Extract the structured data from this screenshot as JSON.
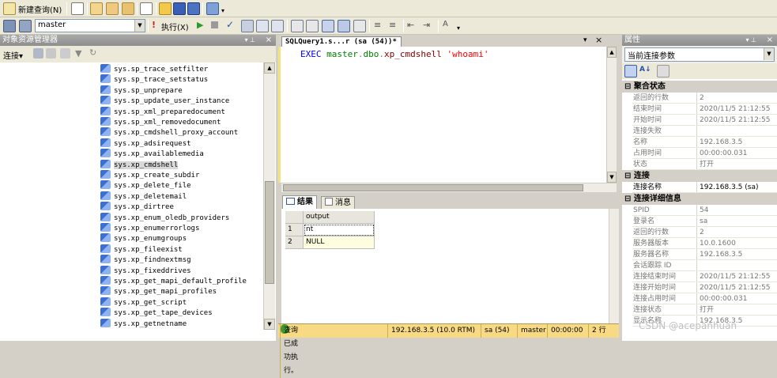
{
  "toolbar1": {
    "new_query_label": "新建查询(N)",
    "icons": [
      "db-engine-query-icon",
      "analysis-query-icon",
      "mdx-query-icon",
      "dmx-query-icon",
      "xmla-query-icon",
      "new-file-icon",
      "open-file-icon",
      "save-icon",
      "save-all-icon",
      "registered-servers-icon",
      "overflow-icon"
    ]
  },
  "toolbar2": {
    "database": "master",
    "execute_label": "执行(X)"
  },
  "object_explorer": {
    "title": "对象资源管理器",
    "connect_label": "连接",
    "items": [
      "sys.sp_trace_setfilter",
      "sys.sp_trace_setstatus",
      "sys.sp_unprepare",
      "sys.sp_update_user_instance",
      "sys.sp_xml_preparedocument",
      "sys.sp_xml_removedocument",
      "sys.xp_cmdshell_proxy_account",
      "sys.xp_adsirequest",
      "sys.xp_availablemedia",
      "sys.xp_cmdshell",
      "sys.xp_create_subdir",
      "sys.xp_delete_file",
      "sys.xp_deletemail",
      "sys.xp_dirtree",
      "sys.xp_enum_oledb_providers",
      "sys.xp_enumerrorlogs",
      "sys.xp_enumgroups",
      "sys.xp_fileexist",
      "sys.xp_findnextmsg",
      "sys.xp_fixeddrives",
      "sys.xp_get_mapi_default_profile",
      "sys.xp_get_mapi_profiles",
      "sys.xp_get_script",
      "sys.xp_get_tape_devices",
      "sys.xp_getnetname"
    ],
    "selected_index": 9
  },
  "editor": {
    "tab_title": "SQLQuery1.s...r (sa (54))*",
    "query": {
      "kw": "EXEC",
      "obj_a": "master",
      "dot1": ".",
      "obj_b": "dbo",
      "dot2": ".",
      "proc": "xp_cmdshell",
      "arg": "'whoami'"
    }
  },
  "results": {
    "tab_results": "结果",
    "tab_messages": "消息",
    "column": "output",
    "rows": [
      {
        "num": "1",
        "value": "nt authority\\system"
      },
      {
        "num": "2",
        "value": "NULL"
      }
    ]
  },
  "status": {
    "message": "查询已成功执行。",
    "server": "192.168.3.5 (10.0 RTM)",
    "user": "sa (54)",
    "db": "master",
    "time": "00:00:00",
    "rows": "2 行"
  },
  "properties": {
    "title": "属性",
    "dropdown": "当前连接参数",
    "cat_aggregate": "聚合状态",
    "aggregate": [
      {
        "k": "返回的行数",
        "v": "2"
      },
      {
        "k": "结束时间",
        "v": "2020/11/5 21:12:55"
      },
      {
        "k": "开始时间",
        "v": "2020/11/5 21:12:55"
      },
      {
        "k": "连接失败",
        "v": ""
      },
      {
        "k": "名称",
        "v": "192.168.3.5"
      },
      {
        "k": "占用时间",
        "v": "00:00:00.031"
      },
      {
        "k": "状态",
        "v": "打开"
      }
    ],
    "cat_connection": "连接",
    "connection": [
      {
        "k": "连接名称",
        "v": "192.168.3.5 (sa)"
      }
    ],
    "cat_detail": "连接详细信息",
    "detail": [
      {
        "k": "SPID",
        "v": "54"
      },
      {
        "k": "登录名",
        "v": "sa"
      },
      {
        "k": "返回的行数",
        "v": "2"
      },
      {
        "k": "服务器版本",
        "v": "10.0.1600"
      },
      {
        "k": "服务器名称",
        "v": "192.168.3.5"
      },
      {
        "k": "会话跟踪 ID",
        "v": ""
      },
      {
        "k": "连接结束时间",
        "v": "2020/11/5 21:12:55"
      },
      {
        "k": "连接开始时间",
        "v": "2020/11/5 21:12:55"
      },
      {
        "k": "连接占用时间",
        "v": "00:00:00.031"
      },
      {
        "k": "连接状态",
        "v": "打开"
      },
      {
        "k": "显示名称",
        "v": "192.168.3.5"
      }
    ]
  },
  "watermark": "CSDN @acepanhuan"
}
